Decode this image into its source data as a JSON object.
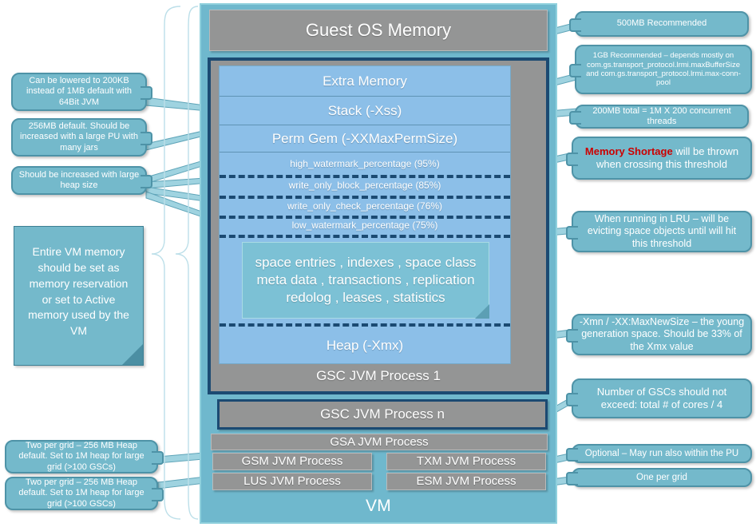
{
  "diagram": {
    "title": "GigaSpaces VM / JVM memory layout",
    "colors": {
      "vm_fill": "#6fb8cd",
      "gray_process": "#949595",
      "heap_blue": "#8cbfe8",
      "inner_teal": "#7cc1d5",
      "callout_fill": "#74b9cb",
      "callout_border": "#4e93a7",
      "navy_border": "#1b4a72",
      "alert_red": "#cc0000"
    }
  },
  "vm": {
    "label": "VM"
  },
  "guest_os": {
    "label": "Guest OS Memory"
  },
  "gsc1": {
    "process_label": "GSC JVM Process 1"
  },
  "gscn": {
    "process_label": "GSC JVM Process n"
  },
  "heap": {
    "extra_memory": "Extra Memory",
    "stack": "Stack (-Xss)",
    "perm_gem": "Perm Gem (-XXMaxPermSize)",
    "heap_label": "Heap (-Xmx)",
    "watermarks": [
      {
        "name": "high_watermark_percentage",
        "value": "(95%)"
      },
      {
        "name": "write_only_block_percentage",
        "value": "(85%)"
      },
      {
        "name": "write_only_check_percentage",
        "value": "(76%)"
      },
      {
        "name": "low_watermark_percentage",
        "value": "(75%)"
      }
    ],
    "watermark_lines": [
      "high_watermark_percentage  (95%)",
      "write_only_block_percentage  (85%)",
      "write_only_check_percentage  (76%)",
      "low_watermark_percentage  (75%)"
    ],
    "space_contents": "space entries , indexes , space class meta data , transactions , replication redolog , leases , statistics"
  },
  "processes": {
    "gsa": "GSA JVM Process",
    "gsm": "GSM JVM Process",
    "txm": "TXM JVM Process",
    "lus": "LUS JVM Process",
    "esm": "ESM JVM Process"
  },
  "callouts": {
    "left": [
      {
        "id": "xss-note",
        "text": "Can be lowered to 200KB instead of 1MB default with 64Bit JVM"
      },
      {
        "id": "permgem-note",
        "text": "256MB default. Should be increased with a large PU with many jars"
      },
      {
        "id": "watermark-note",
        "text": "Should be increased with large heap size"
      }
    ],
    "left_note": {
      "id": "vm-reservation-note",
      "text": "Entire VM memory should be set as memory reservation or set to Active memory used by the VM"
    },
    "left_bottom": [
      {
        "id": "gsm-note",
        "text": "Two per grid – 256 MB Heap default. Set to 1M heap for large grid (>100 GSCs)"
      },
      {
        "id": "lus-note",
        "text": "Two per grid – 256 MB Heap default. Set to 1M heap for large grid (>100 GSCs)"
      }
    ],
    "right": [
      {
        "id": "guest-os-note",
        "text": "500MB Recommended"
      },
      {
        "id": "extra-memory-note",
        "text": "1GB Recommended – depends mostly on com.gs.transport_protocol.lrmi.maxBufferSize and com.gs.transport_protocol.lrmi.max-conn-pool"
      },
      {
        "id": "stack-note",
        "text": "200MB total = 1M X 200 concurrent threads"
      },
      {
        "id": "memory-shortage-note",
        "text_prefix": "Memory Shortage",
        "text_rest": " will be thrown when crossing this threshold"
      },
      {
        "id": "lru-note",
        "text": "When running in LRU – will be evicting space objects until  will hit this threshold"
      },
      {
        "id": "xmn-note",
        "text": "-Xmn / -XX:MaxNewSize  – the young generation space. Should be 33% of the Xmx value"
      },
      {
        "id": "gsc-count-note",
        "text": "Number of GSCs should not exceed: total # of cores / 4"
      },
      {
        "id": "txm-note",
        "text": "Optional – May run also within the PU"
      },
      {
        "id": "esm-note",
        "text": "One per grid"
      }
    ]
  }
}
